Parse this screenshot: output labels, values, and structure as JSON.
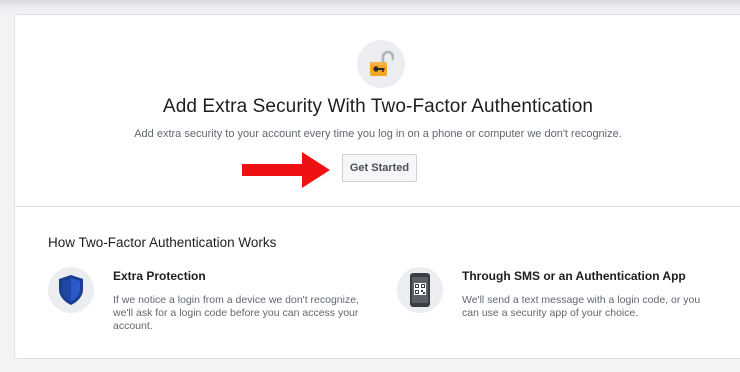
{
  "hero": {
    "title": "Add Extra Security With Two-Factor Authentication",
    "description": "Add extra security to your account every time you log in on a phone or computer we don't recognize.",
    "button_label": "Get Started",
    "icon": "padlock-key-icon"
  },
  "annotation": {
    "icon": "red-arrow-icon",
    "color": "#ee1111"
  },
  "how": {
    "title": "How Two-Factor Authentication Works",
    "features": [
      {
        "icon": "shield-icon",
        "title": "Extra Protection",
        "description": "If we notice a login from a device we don't recognize, we'll ask for a login code before you can access your account."
      },
      {
        "icon": "phone-qr-code-icon",
        "title": "Through SMS or an Authentication App",
        "description": "We'll send a text message with a login code, or you can use a security app of your choice."
      }
    ]
  },
  "colors": {
    "shield": "#1b3d8f",
    "padlock": "#f5a623",
    "phone": "#3a3d42"
  }
}
